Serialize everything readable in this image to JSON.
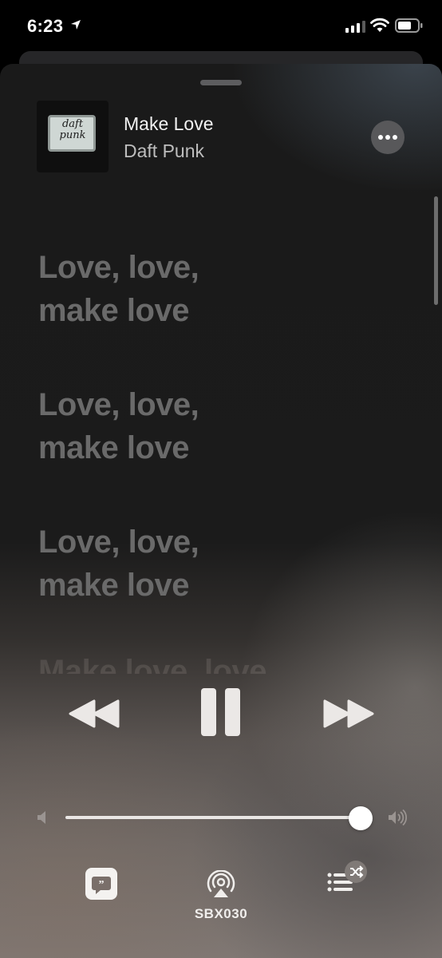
{
  "status_bar": {
    "time": "6:23",
    "icons": [
      "location-arrow-icon",
      "cellular-signal-icon",
      "wifi-icon",
      "battery-icon"
    ]
  },
  "now_playing": {
    "album_art_text": "daft punk",
    "title": "Make Love",
    "artist": "Daft Punk"
  },
  "lyrics": [
    {
      "lines": [
        "Love, love,",
        "make love"
      ]
    },
    {
      "lines": [
        "Love, love,",
        "make love"
      ]
    },
    {
      "lines": [
        "Love, love,",
        "make love"
      ]
    },
    {
      "lines": [
        "Make love, love"
      ]
    }
  ],
  "playback": {
    "state": "playing",
    "volume_level": 0.96
  },
  "bottom_bar": {
    "device_label": "SBX030",
    "icons": [
      "lyrics-icon",
      "airplay-icon",
      "queue-icon",
      "shuffle-icon"
    ]
  },
  "colors": {
    "lyric_inactive": "#6a6a6a",
    "more_button_bg": "#58585a",
    "control_fill": "#ebe8e6"
  }
}
